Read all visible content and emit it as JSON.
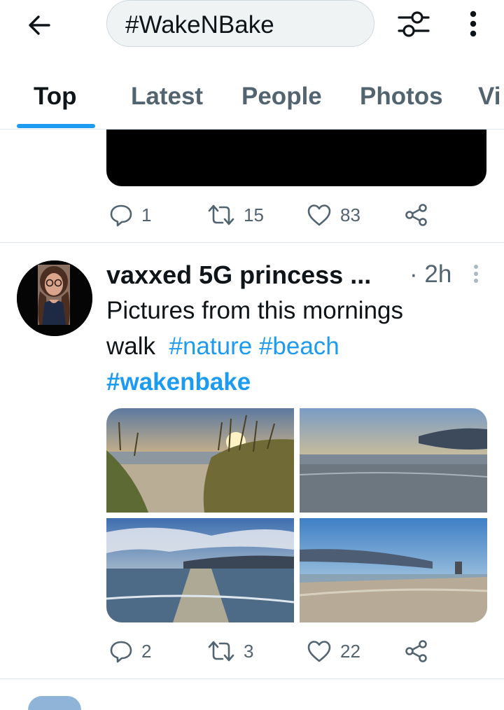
{
  "search": {
    "query": "#WakeNBake"
  },
  "icons": {
    "back": "arrow-left-icon",
    "filter": "sliders-icon",
    "more": "more-vertical-icon",
    "reply": "reply-icon",
    "retweet": "retweet-icon",
    "like": "heart-icon",
    "share": "share-icon"
  },
  "tabs": [
    {
      "label": "Top",
      "active": true
    },
    {
      "label": "Latest",
      "active": false
    },
    {
      "label": "People",
      "active": false
    },
    {
      "label": "Photos",
      "active": false
    },
    {
      "label": "Vi",
      "active": false
    }
  ],
  "prev_tweet": {
    "replies": "1",
    "retweets": "15",
    "likes": "83"
  },
  "tweet": {
    "display_name": "vaxxed 5G princess ...",
    "time": "· 2h",
    "text_line1": "Pictures from this mornings",
    "text_line2_plain": "walk",
    "hashtag_nature": "#nature",
    "hashtag_beach": "#beach",
    "hashtag_wakenbake": "#wakenbake",
    "replies": "2",
    "retweets": "3",
    "likes": "22"
  },
  "colors": {
    "accent": "#1d9bf0",
    "text": "#0f1419",
    "muted": "#536471",
    "divider": "#e1e8ed"
  }
}
